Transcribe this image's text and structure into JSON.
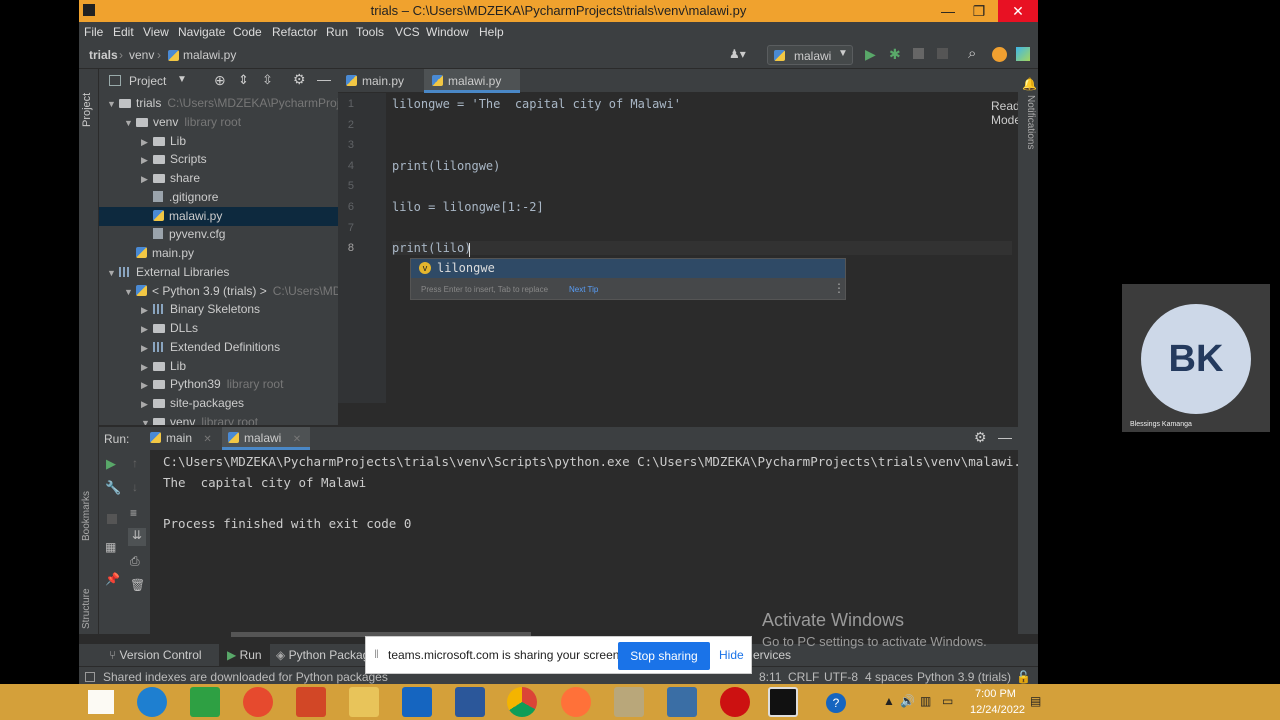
{
  "window": {
    "title": "trials – C:\\Users\\MDZEKA\\PycharmProjects\\trials\\venv\\malawi.py"
  },
  "menu": [
    "File",
    "Edit",
    "View",
    "Navigate",
    "Code",
    "Refactor",
    "Run",
    "Tools",
    "VCS",
    "Window",
    "Help"
  ],
  "breadcrumb": [
    "trials",
    "venv",
    "malawi.py"
  ],
  "run_config": "malawi",
  "project_panel": {
    "title": "Project"
  },
  "tree": [
    {
      "label": "trials",
      "hint": "C:\\Users\\MDZEKA\\PycharmProjects\\trials",
      "icon": "folder",
      "arrow": "▼",
      "depth": 0
    },
    {
      "label": "venv",
      "hint": "library root",
      "icon": "folder",
      "arrow": "▼",
      "depth": 1
    },
    {
      "label": "Lib",
      "hint": "",
      "icon": "folder",
      "arrow": "▶",
      "depth": 2
    },
    {
      "label": "Scripts",
      "hint": "",
      "icon": "folder",
      "arrow": "▶",
      "depth": 2
    },
    {
      "label": "share",
      "hint": "",
      "icon": "folder",
      "arrow": "▶",
      "depth": 2
    },
    {
      "label": ".gitignore",
      "hint": "",
      "icon": "file",
      "arrow": "",
      "depth": 2
    },
    {
      "label": "malawi.py",
      "hint": "",
      "icon": "py",
      "arrow": "",
      "depth": 2,
      "selected": true
    },
    {
      "label": "pyvenv.cfg",
      "hint": "",
      "icon": "file",
      "arrow": "",
      "depth": 2
    },
    {
      "label": "main.py",
      "hint": "",
      "icon": "py",
      "arrow": "",
      "depth": 1
    },
    {
      "label": "External Libraries",
      "hint": "",
      "icon": "lib",
      "arrow": "▼",
      "depth": 0
    },
    {
      "label": "< Python 3.9 (trials) >",
      "hint": "C:\\Users\\MDZEKA",
      "icon": "py",
      "arrow": "▼",
      "depth": 1
    },
    {
      "label": "Binary Skeletons",
      "hint": "",
      "icon": "lib",
      "arrow": "▶",
      "depth": 2
    },
    {
      "label": "DLLs",
      "hint": "",
      "icon": "folder",
      "arrow": "▶",
      "depth": 2
    },
    {
      "label": "Extended Definitions",
      "hint": "",
      "icon": "lib",
      "arrow": "▶",
      "depth": 2
    },
    {
      "label": "Lib",
      "hint": "",
      "icon": "folder",
      "arrow": "▶",
      "depth": 2
    },
    {
      "label": "Python39",
      "hint": "library root",
      "icon": "folder",
      "arrow": "▶",
      "depth": 2
    },
    {
      "label": "site-packages",
      "hint": "",
      "icon": "folder",
      "arrow": "▶",
      "depth": 2
    },
    {
      "label": "venv",
      "hint": "library root",
      "icon": "folder",
      "arrow": "▼",
      "depth": 2
    }
  ],
  "tabs": [
    {
      "label": "main.py",
      "active": false
    },
    {
      "label": "malawi.py",
      "active": true
    }
  ],
  "editor": {
    "reader_mode": "Reader Mode",
    "line_numbers": [
      "1",
      "2",
      "3",
      "4",
      "5",
      "6",
      "7",
      "8"
    ],
    "lines": [
      "lilongwe = 'The  capital city of Malawi'",
      "",
      "",
      "print(lilongwe)",
      "",
      "lilo = lilongwe[1:-2]",
      "",
      "print(lilo)"
    ]
  },
  "completion": {
    "item": "lilongwe",
    "hint": "Press Enter to insert, Tab to replace",
    "next_tip": "Next Tip"
  },
  "run": {
    "label": "Run:",
    "tabs": [
      "main",
      "malawi"
    ]
  },
  "console": [
    "C:\\Users\\MDZEKA\\PycharmProjects\\trials\\venv\\Scripts\\python.exe C:\\Users\\MDZEKA\\PycharmProjects\\trials\\venv\\malawi.",
    "The  capital city of Malawi",
    "",
    "Process finished with exit code 0"
  ],
  "side_labels": {
    "project": "Project",
    "bookmarks": "Bookmarks",
    "structure": "Structure",
    "notifications": "Notifications"
  },
  "bottom_tabs": [
    "Version Control",
    "Run",
    "Python Packag",
    "ervices"
  ],
  "status": {
    "message": "Shared indexes are downloaded for Python packages",
    "position": "8:11",
    "line_sep": "CRLF",
    "encoding": "UTF-8",
    "indent": "4 spaces",
    "interpreter": "Python 3.9 (trials)"
  },
  "activate": {
    "title": "Activate Windows",
    "subtitle": "Go to PC settings to activate Windows."
  },
  "share": {
    "text": "teams.microsoft.com is sharing your screen.",
    "stop": "Stop sharing",
    "hide": "Hide"
  },
  "teams": {
    "initials": "BK",
    "name": "Blessings Kamanga"
  },
  "clock": {
    "time": "7:00 PM",
    "date": "12/24/2022"
  },
  "colors": {
    "titlebar": "#f0a22e",
    "accent": "#1a73e8",
    "taskbar": "#d4a03a"
  }
}
